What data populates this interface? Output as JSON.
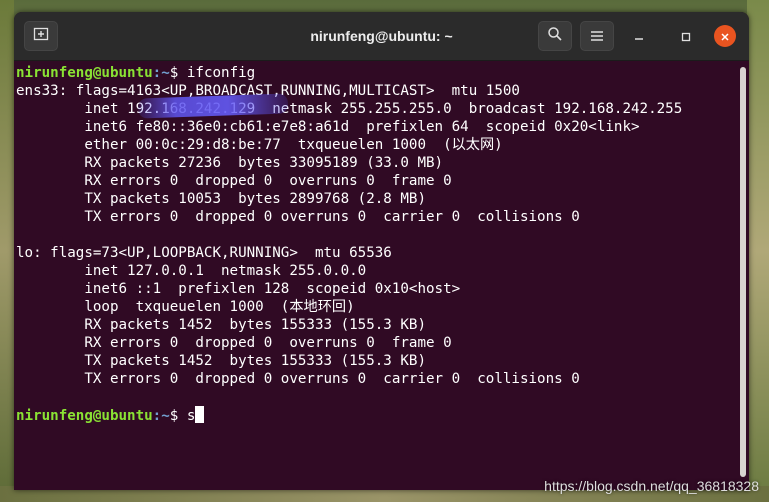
{
  "window": {
    "title": "nirunfeng@ubuntu: ~"
  },
  "titlebar": {
    "new_tab_icon": "new-tab-icon",
    "search_icon": "search-icon",
    "menu_icon": "hamburger-menu-icon",
    "minimize_icon": "minimize-icon",
    "maximize_icon": "maximize-icon",
    "close_icon": "close-icon"
  },
  "terminal": {
    "prompt1": {
      "user": "nirunfeng@ubuntu",
      "path": ":~",
      "symbol": "$ ",
      "command": "ifconfig"
    },
    "lines": [
      "ens33: flags=4163<UP,BROADCAST,RUNNING,MULTICAST>  mtu 1500",
      "        inet 192.168.242.129  netmask 255.255.255.0  broadcast 192.168.242.255",
      "        inet6 fe80::36e0:cb61:e7e8:a61d  prefixlen 64  scopeid 0x20<link>",
      "        ether 00:0c:29:d8:be:77  txqueuelen 1000  (以太网)",
      "        RX packets 27236  bytes 33095189 (33.0 MB)",
      "        RX errors 0  dropped 0  overruns 0  frame 0",
      "        TX packets 10053  bytes 2899768 (2.8 MB)",
      "        TX errors 0  dropped 0 overruns 0  carrier 0  collisions 0",
      "",
      "lo: flags=73<UP,LOOPBACK,RUNNING>  mtu 65536",
      "        inet 127.0.0.1  netmask 255.0.0.0",
      "        inet6 ::1  prefixlen 128  scopeid 0x10<host>",
      "        loop  txqueuelen 1000  (本地环回)",
      "        RX packets 1452  bytes 155333 (155.3 KB)",
      "        RX errors 0  dropped 0  overruns 0  frame 0",
      "        TX packets 1452  bytes 155333 (155.3 KB)",
      "        TX errors 0  dropped 0 overruns 0  carrier 0  collisions 0",
      ""
    ],
    "prompt2": {
      "user": "nirunfeng@ubuntu",
      "path": ":~",
      "symbol": "$ ",
      "command": "s"
    }
  },
  "watermark": "https://blog.csdn.net/qq_36818328",
  "colors": {
    "terminal_bg": "#300a24",
    "prompt_user": "#8ae234",
    "prompt_path": "#729fcf",
    "close_button": "#e95420"
  }
}
